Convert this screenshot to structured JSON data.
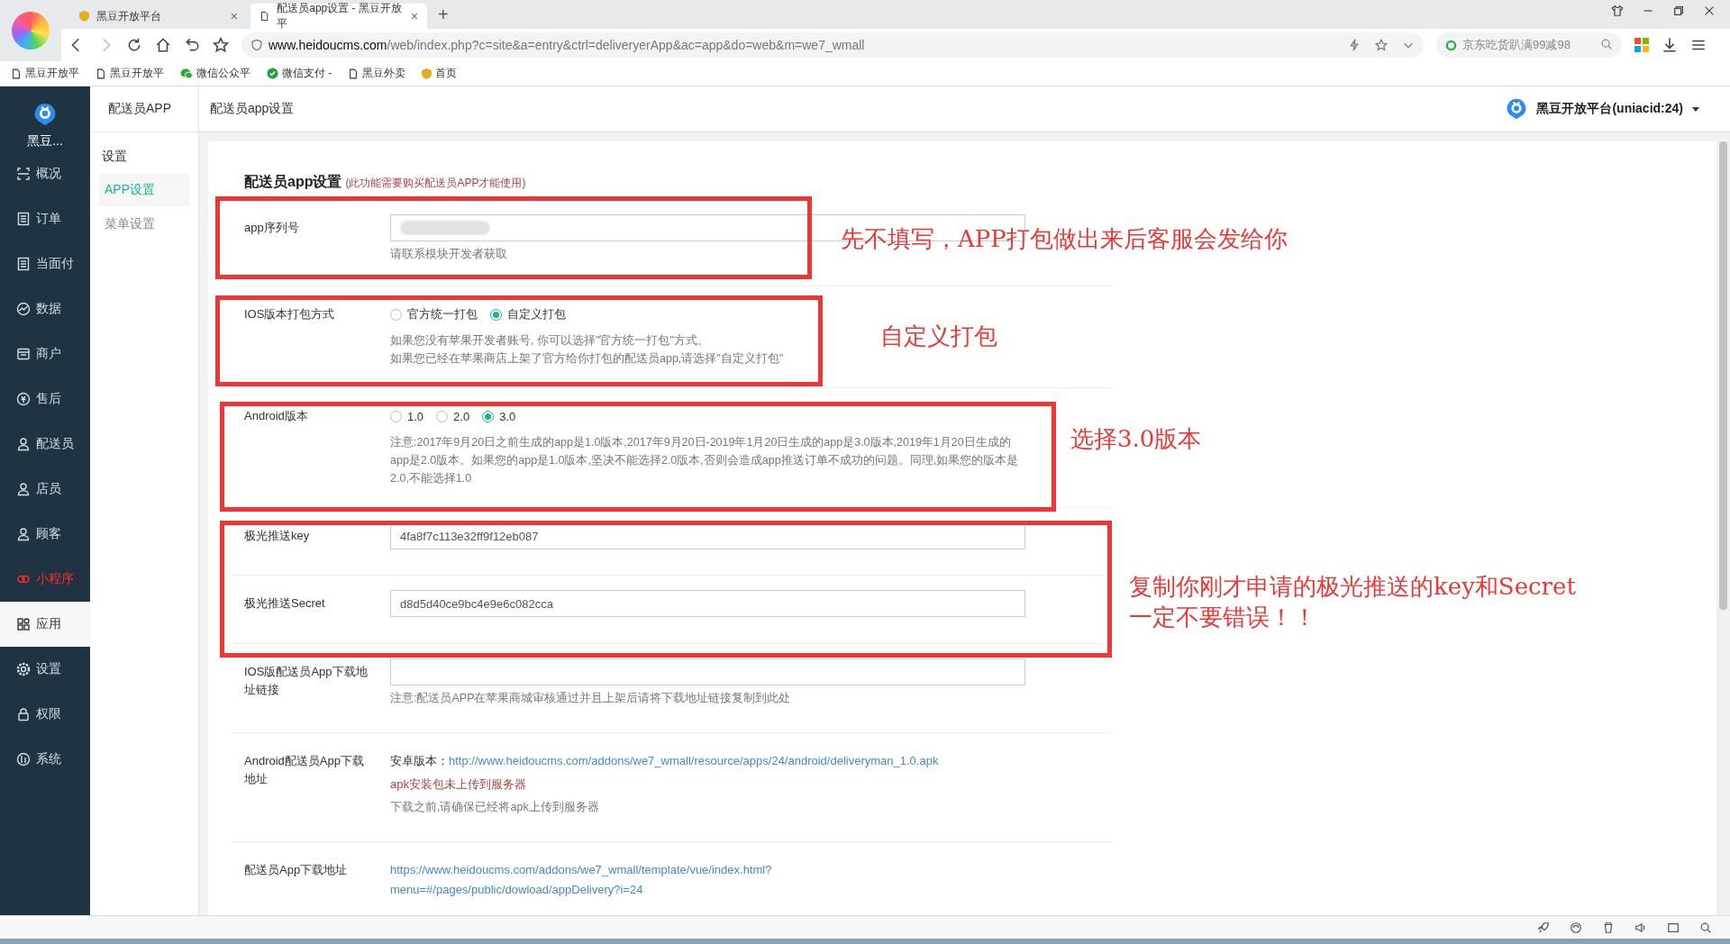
{
  "browser": {
    "tabs": [
      {
        "label": "黑豆开放平台",
        "selected": false,
        "close": "×"
      },
      {
        "label": "配送员app设置 - 黑豆开放平",
        "selected": true,
        "close": "×"
      }
    ],
    "new_tab": "+",
    "address_host": "www.heidoucms.com",
    "address_path": "/web/index.php?c=site&a=entry&ctrl=deliveryerApp&ac=app&do=web&m=we7_wmall",
    "search_hint": "京东吃货趴满99减98",
    "bookmarks": [
      {
        "label": "黑豆开放平",
        "kind": "page"
      },
      {
        "label": "黑豆开放平",
        "kind": "page"
      },
      {
        "label": "微信公众平",
        "kind": "wechat"
      },
      {
        "label": "微信支付 -",
        "kind": "pay"
      },
      {
        "label": "黑豆外卖",
        "kind": "page"
      },
      {
        "label": "首页",
        "kind": "shield"
      }
    ]
  },
  "sidebar": {
    "brand": "黑豆...",
    "items": [
      {
        "label": "概况",
        "selected": false,
        "accent": false
      },
      {
        "label": "订单",
        "selected": false,
        "accent": false
      },
      {
        "label": "当面付",
        "selected": false,
        "accent": false
      },
      {
        "label": "数据",
        "selected": false,
        "accent": false
      },
      {
        "label": "商户",
        "selected": false,
        "accent": false
      },
      {
        "label": "售后",
        "selected": false,
        "accent": false
      },
      {
        "label": "配送员",
        "selected": false,
        "accent": false
      },
      {
        "label": "店员",
        "selected": false,
        "accent": false
      },
      {
        "label": "顾客",
        "selected": false,
        "accent": false
      },
      {
        "label": "小程序",
        "selected": false,
        "accent": true
      },
      {
        "label": "应用",
        "selected": true,
        "accent": false
      },
      {
        "label": "设置",
        "selected": false,
        "accent": false
      },
      {
        "label": "权限",
        "selected": false,
        "accent": false
      },
      {
        "label": "系统",
        "selected": false,
        "accent": false
      }
    ]
  },
  "subnav": {
    "title": "配送员APP",
    "section": "设置",
    "items": [
      {
        "label": "APP设置",
        "selected": true
      },
      {
        "label": "菜单设置",
        "selected": false
      }
    ]
  },
  "header": {
    "breadcrumb": "配送员app设置",
    "account": "黑豆开放平台(uniacid:24)"
  },
  "form": {
    "title": "配送员app设置",
    "title_note": "(此功能需要购买配送员APP才能使用)",
    "rows": [
      {
        "kind": "input",
        "label": "app序列号",
        "redacted": true,
        "help": "请联系模块开发者获取"
      },
      {
        "kind": "radio",
        "label": "IOS版本打包方式",
        "options": [
          {
            "label": "官方统一打包",
            "selected": false
          },
          {
            "label": "自定义打包",
            "selected": true
          }
        ],
        "help_lines": [
          "如果您没有苹果开发者账号, 你可以选择\"官方统一打包\"方式。",
          "如果您已经在苹果商店上架了官方给你打包的配送员app,请选择\"自定义打包\""
        ]
      },
      {
        "kind": "radio",
        "label": "Android版本",
        "options": [
          {
            "label": "1.0",
            "selected": false
          },
          {
            "label": "2.0",
            "selected": false
          },
          {
            "label": "3.0",
            "selected": true
          }
        ],
        "help_lines": [
          "注意:2017年9月20日之前生成的app是1.0版本,2017年9月20日-2019年1月20日生成的app是3.0版本,2019年1月20日生成的app是2.0版本。如果您的app是1.0版本,坚决不能选择2.0版本,否则会造成app推送订单不成功的问题。同理,如果您的版本是2.0,不能选择1.0"
        ]
      },
      {
        "kind": "input",
        "label": "极光推送key",
        "value": "4fa8f7c113e32ff9f12eb087"
      },
      {
        "kind": "input",
        "label": "极光推送Secret",
        "value": "d8d5d40ce9bc4e9e6c082cca"
      },
      {
        "kind": "input",
        "label": "IOS版配送员App下载地址链接",
        "help": "注意:配送员APP在苹果商城审核通过并且上架后请将下载地址链接复制到此处"
      },
      {
        "kind": "download",
        "label": "Android配送员App下载地址",
        "prefix": "安卓版本：",
        "link": "http://www.heidoucms.com/addons/we7_wmall/resource/apps/24/android/deliveryman_1.0.apk",
        "warning": "apk安装包未上传到服务器",
        "note": "下载之前,请确保已经将apk上传到服务器"
      },
      {
        "kind": "link",
        "label": "配送员App下载地址",
        "link_lines": [
          "https://www.heidoucms.com/addons/we7_wmall/template/vue/index.html?",
          "menu=#/pages/public/dowload/appDelivery?i=24"
        ]
      }
    ]
  },
  "annotations": [
    {
      "lines": [
        "先不填写，APP打包做出来后客服会发给你"
      ]
    },
    {
      "lines": [
        "自定义打包"
      ]
    },
    {
      "lines": [
        "选择3.0版本"
      ]
    },
    {
      "lines": [
        "复制你刚才申请的极光推送的key和Secret",
        "一定不要错误！！"
      ]
    }
  ]
}
